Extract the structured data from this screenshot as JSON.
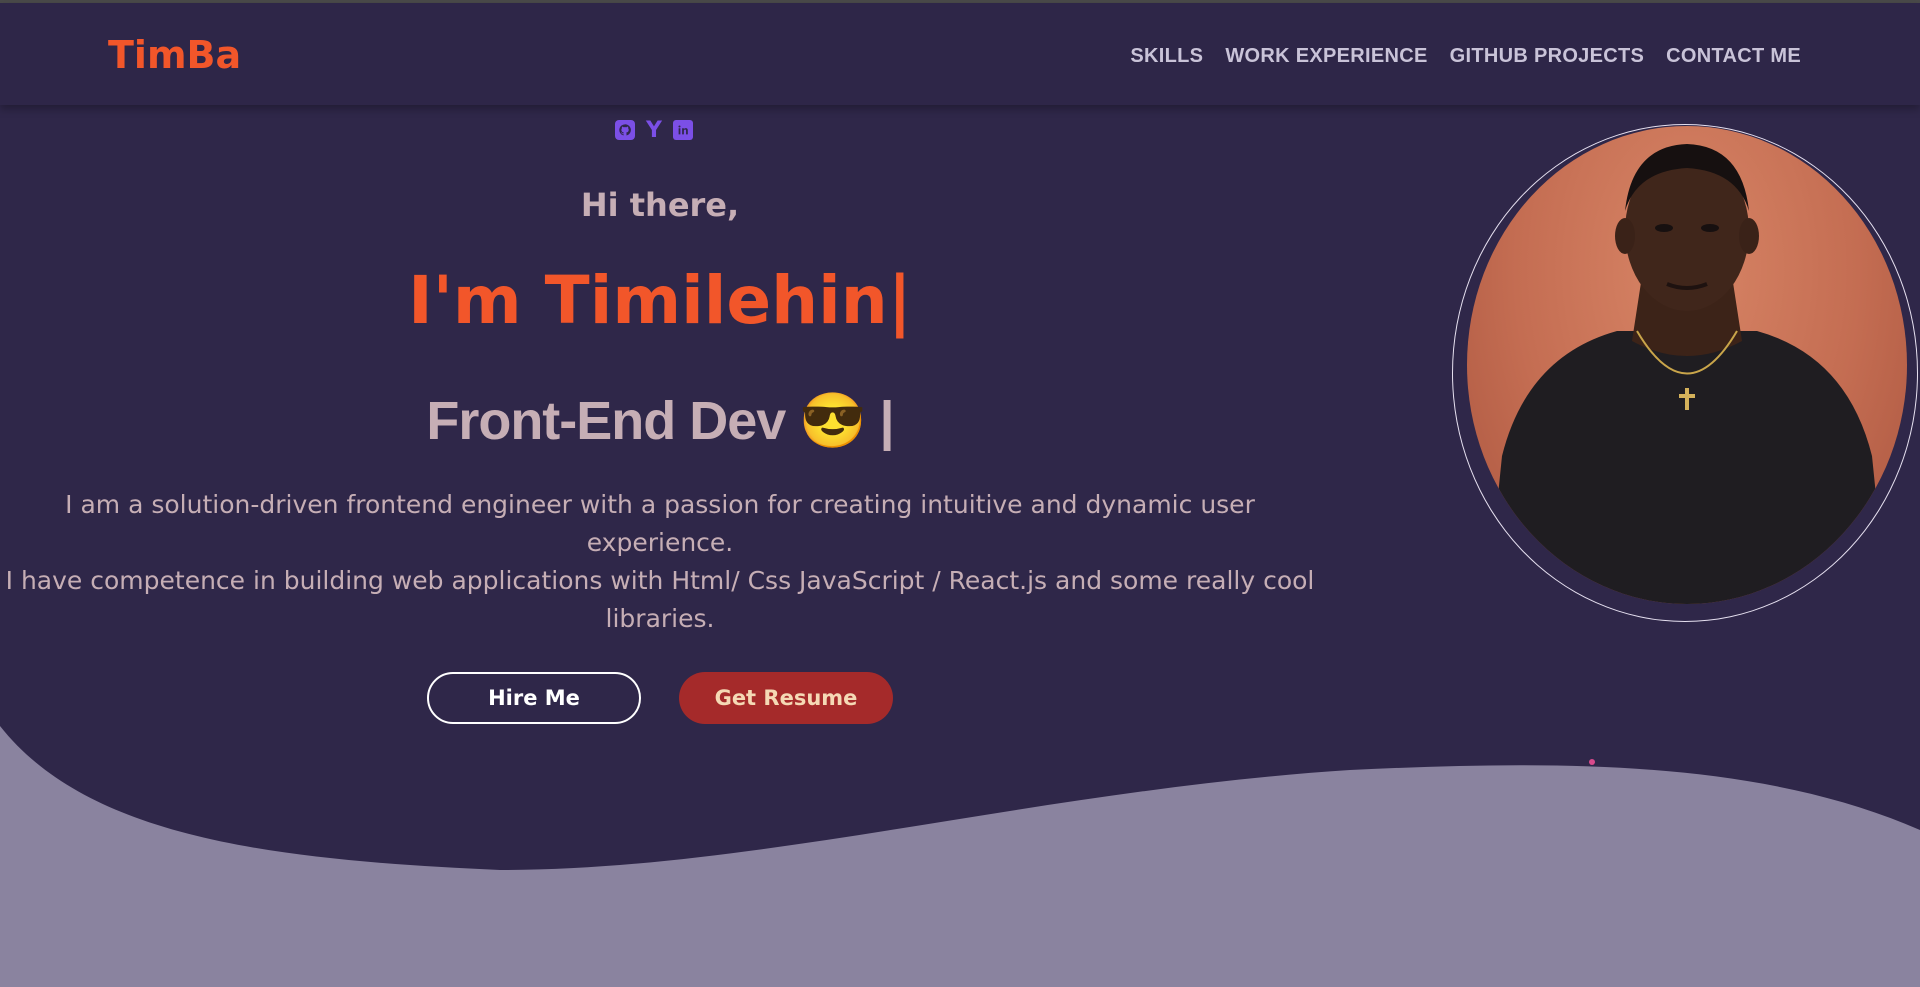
{
  "brand": {
    "logo": "TimBa",
    "accent": "#f2562a"
  },
  "nav": {
    "links": [
      "SKILLS",
      "WORK EXPERIENCE",
      "GITHUB PROJECTS",
      "CONTACT ME"
    ]
  },
  "social": {
    "icons": [
      "github-icon",
      "y-combinator-icon",
      "linkedin-icon"
    ],
    "y_glyph": "Y"
  },
  "hero": {
    "greeting": "Hi there,",
    "name": "I'm Timilehin|",
    "role": "Front-End Dev 😎 |",
    "bio_line1": "I am a solution-driven frontend engineer with a passion for creating intuitive and dynamic user experience.",
    "bio_line2": "I have competence in building web applications with Html/ Css JavaScript / React.js and some really cool libraries."
  },
  "buttons": {
    "hire": "Hire Me",
    "resume": "Get Resume"
  },
  "colors": {
    "background": "#2f2749",
    "wave": "#8a839f",
    "resume_button": "#a52a2a",
    "text_muted": "#c6aeb5"
  }
}
